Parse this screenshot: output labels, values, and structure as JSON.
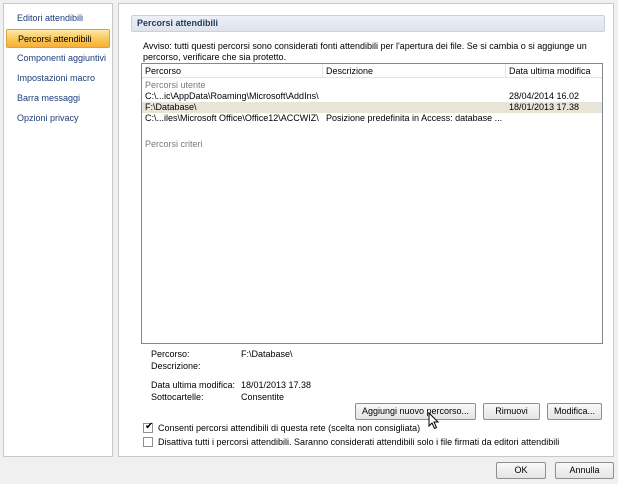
{
  "sidebar": {
    "items": [
      {
        "label": "Editori attendibili",
        "selected": false
      },
      {
        "label": "Percorsi attendibili",
        "selected": true
      },
      {
        "label": "Componenti aggiuntivi",
        "selected": false
      },
      {
        "label": "Impostazioni macro",
        "selected": false
      },
      {
        "label": "Barra messaggi",
        "selected": false
      },
      {
        "label": "Opzioni privacy",
        "selected": false
      }
    ]
  },
  "main": {
    "section_title": "Percorsi attendibili",
    "warning": "Avviso: tutti questi percorsi sono considerati fonti attendibili per l'apertura dei file. Se si cambia o si aggiunge un percorso, verificare che sia protetto.",
    "columns": [
      "Percorso",
      "Descrizione",
      "Data ultima modifica"
    ],
    "group_user": "Percorsi utente",
    "rows": [
      {
        "path": "C:\\...ic\\AppData\\Roaming\\Microsoft\\AddIns\\",
        "description": "",
        "date": "28/04/2014 16.02",
        "selected": false
      },
      {
        "path": "F:\\Database\\",
        "description": "",
        "date": "18/01/2013 17.38",
        "selected": true
      },
      {
        "path": "C:\\...iles\\Microsoft Office\\Office12\\ACCWIZ\\",
        "description": "Posizione predefinita in Access: database ...",
        "date": "",
        "selected": false
      }
    ],
    "group_policy": "Percorsi criteri",
    "details": {
      "path_label": "Percorso:",
      "path_value": "F:\\Database\\",
      "desc_label": "Descrizione:",
      "desc_value": "",
      "date_label": "Data ultima modifica:",
      "date_value": "18/01/2013 17.38",
      "sub_label": "Sottocartelle:",
      "sub_value": "Consentite"
    },
    "buttons": {
      "add": "Aggiungi nuovo percorso...",
      "remove": "Rimuovi",
      "modify": "Modifica..."
    },
    "checkboxes": [
      {
        "label": "Consenti percorsi attendibili di questa rete (scelta non consigliata)",
        "checked": true
      },
      {
        "label": "Disattiva tutti i percorsi attendibili. Saranno considerati attendibili solo i file firmati da editori attendibili",
        "checked": false
      }
    ]
  },
  "footer": {
    "ok": "OK",
    "cancel": "Annulla"
  }
}
